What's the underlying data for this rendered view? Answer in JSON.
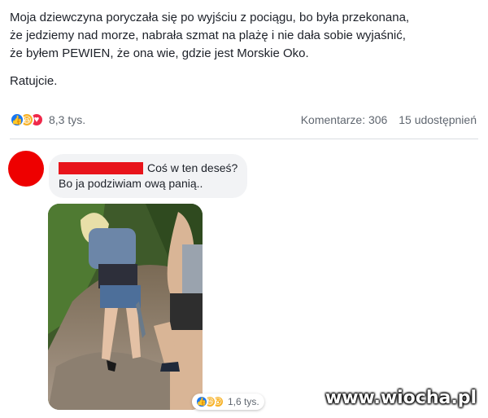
{
  "post": {
    "lines": [
      "Moja dziewczyna poryczała się po wyjściu z pociągu, bo była przekonana,",
      "że jedziemy nad morze, nabrała szmat na plażę i nie dała sobie wyjaśnić,",
      "że byłem PEWIEN, że ona wie, gdzie jest Morskie Oko."
    ],
    "closing": "Ratujcie."
  },
  "stats": {
    "reaction_icons": [
      "like-icon",
      "haha-icon",
      "love-icon"
    ],
    "reaction_count": "8,3 tys.",
    "comments": "Komentarze: 306",
    "shares": "15 udostępnień"
  },
  "comment": {
    "line1": "Coś w ten deseś?",
    "line2": "Bo ja podziwiam ową panią..",
    "photo_reactions": {
      "icons": [
        "like-icon",
        "haha-icon",
        "wow-icon"
      ],
      "count": "1,6 tys."
    }
  },
  "colors": {
    "avatar": "#ee0000",
    "redaction": "#e8141b",
    "like": "#1877f2",
    "love": "#f0284a",
    "haha": "#f7b125"
  },
  "watermark": "www.wiocha.pl"
}
